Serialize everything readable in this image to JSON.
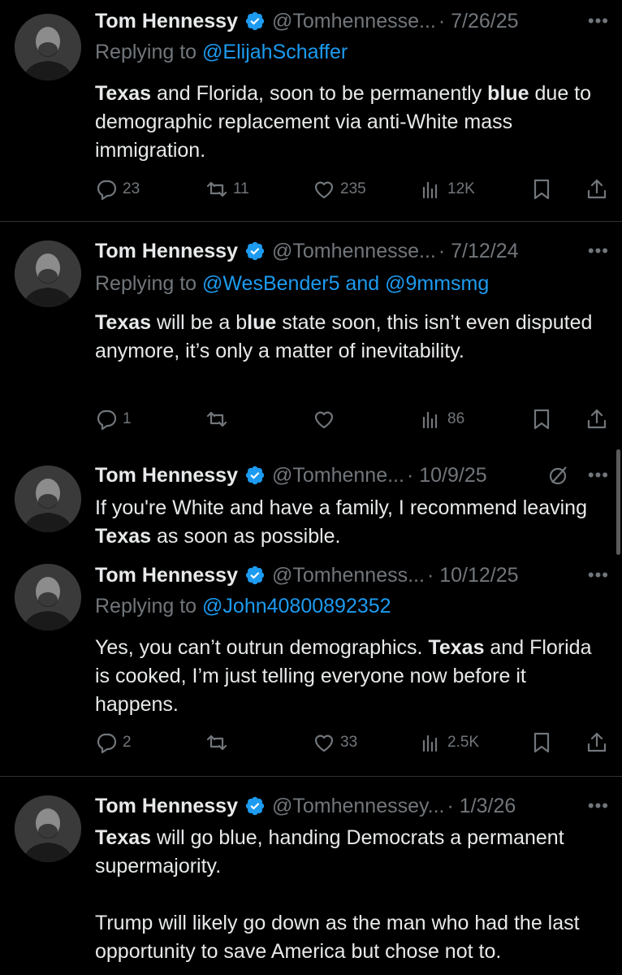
{
  "colors": {
    "background": "#000000",
    "text": "#e7e9ea",
    "muted": "#71767b",
    "link": "#1d9bf0",
    "verified": "#1d9bf0",
    "divider": "#2f3336"
  },
  "tweets": [
    {
      "name": "Tom Hennessy",
      "handle": "@Tomhennesse...",
      "date": "· 7/26/25",
      "replying_prefix": "Replying to ",
      "replying_to": "@ElijahSchaffer",
      "text": [
        {
          "t": "Texas",
          "b": true
        },
        {
          "t": " and Florida, soon to be permanently ",
          "b": false
        },
        {
          "t": "blue",
          "b": true
        },
        {
          "t": " due to demographic replacement via anti-White mass immigration.",
          "b": false
        }
      ],
      "replies": "23",
      "reposts": "11",
      "likes": "235",
      "views": "12K"
    },
    {
      "name": "Tom Hennessy",
      "handle": "@Tomhennesse...",
      "date": "· 7/12/24",
      "replying_prefix": "Replying to ",
      "replying_to": "@WesBender5 and @9mmsmg",
      "text": [
        {
          "t": "Texas",
          "b": true
        },
        {
          "t": " will be a b",
          "b": false
        },
        {
          "t": "lue",
          "b": true
        },
        {
          "t": " state soon, this isn’t even disputed anymore, it’s only a matter of inevitability.",
          "b": false
        }
      ],
      "replies": "1",
      "reposts": "",
      "likes": "",
      "views": "86"
    },
    {
      "name": "Tom Hennessy",
      "handle": "@Tomhenne...",
      "date": "· 10/9/25",
      "text": [
        {
          "t": "If you're White and have a family, I recommend leaving ",
          "b": false
        },
        {
          "t": "Texas",
          "b": true
        },
        {
          "t": " as soon as possible.",
          "b": false
        }
      ]
    },
    {
      "name": "Tom Hennessy",
      "handle": "@Tomhenness...",
      "date": "· 10/12/25",
      "replying_prefix": "Replying to ",
      "replying_to": "@John40800892352",
      "text": [
        {
          "t": "Yes, you can’t outrun demographics. ",
          "b": false
        },
        {
          "t": "Texas",
          "b": true
        },
        {
          "t": " and Florida is cooked, I’m just telling everyone now before it happens.",
          "b": false
        }
      ],
      "replies": "2",
      "reposts": "",
      "likes": "33",
      "views": "2.5K"
    },
    {
      "name": "Tom Hennessy",
      "handle": "@Tomhennessey...",
      "date": "· 1/3/26",
      "text": [
        {
          "t": "Texas",
          "b": true
        },
        {
          "t": " will go blue, handing Democrats a permanent supermajority.",
          "b": false
        },
        {
          "t": "\n\nTrump will likely go down as the man who had the last opportunity to save America but chose not to.",
          "b": false
        }
      ]
    }
  ],
  "icons": {
    "more": "more-icon",
    "verified": "verified-badge-icon",
    "edited": "edited-icon"
  }
}
